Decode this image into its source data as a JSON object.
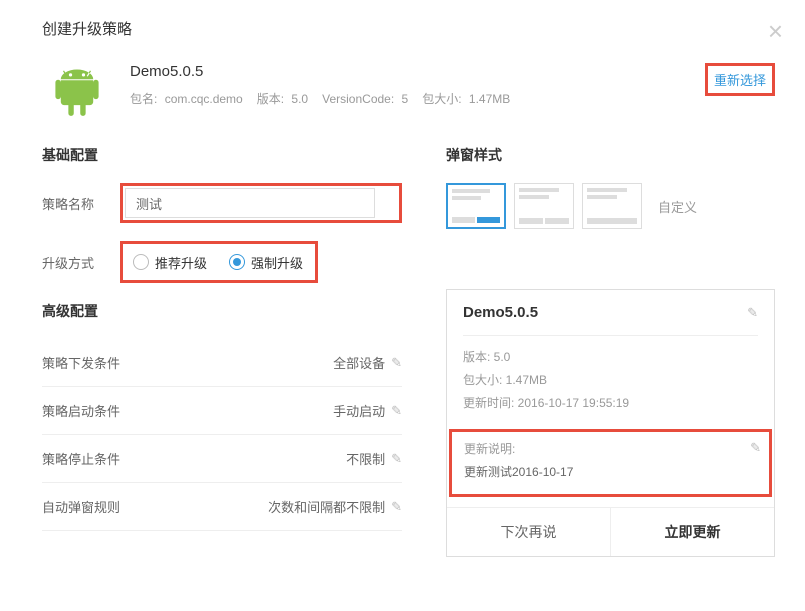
{
  "header": {
    "title": "创建升级策略"
  },
  "package": {
    "name": "Demo5.0.5",
    "pkg_label": "包名:",
    "pkg_value": "com.cqc.demo",
    "ver_label": "版本:",
    "ver_value": "5.0",
    "vc_label": "VersionCode:",
    "vc_value": "5",
    "size_label": "包大小:",
    "size_value": "1.47MB",
    "reselect": "重新选择"
  },
  "basic": {
    "title": "基础配置",
    "name_label": "策略名称",
    "name_value": "测试",
    "method_label": "升级方式",
    "method_recommend": "推荐升级",
    "method_force": "强制升级"
  },
  "advanced": {
    "title": "高级配置",
    "items": [
      {
        "label": "策略下发条件",
        "value": "全部设备"
      },
      {
        "label": "策略启动条件",
        "value": "手动启动"
      },
      {
        "label": "策略停止条件",
        "value": "不限制"
      },
      {
        "label": "自动弹窗规则",
        "value": "次数和间隔都不限制"
      }
    ]
  },
  "popup": {
    "title": "弹窗样式",
    "custom": "自定义"
  },
  "preview": {
    "title": "Demo5.0.5",
    "version": "版本: 5.0",
    "size": "包大小: 1.47MB",
    "time": "更新时间: 2016-10-17 19:55:19",
    "desc_label": "更新说明:",
    "desc_text": "更新测试2016-10-17",
    "later": "下次再说",
    "now": "立即更新"
  }
}
